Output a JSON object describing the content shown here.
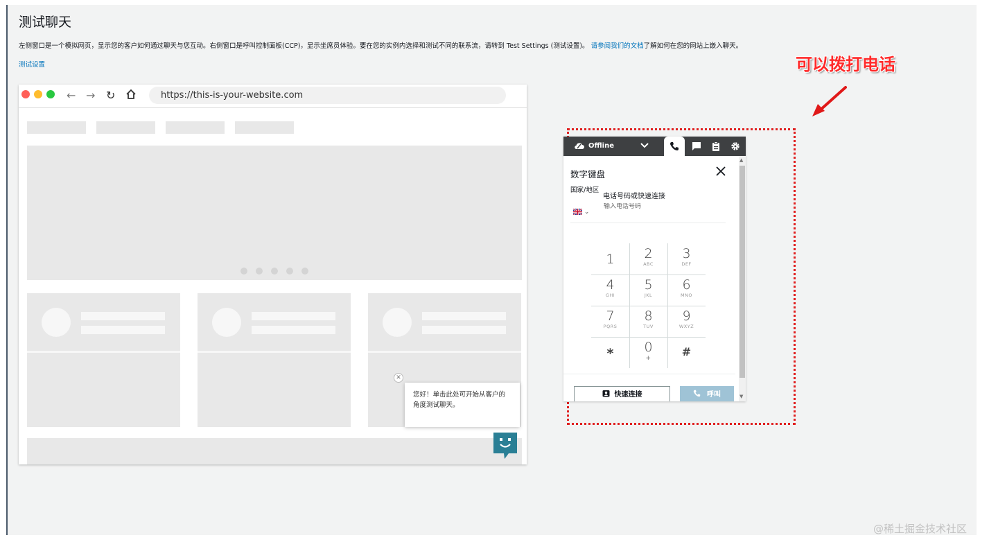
{
  "page": {
    "title": "测试聊天",
    "intro_text": "左侧窗口是一个模拟网页，显示您的客户如何通过聊天与您互动。右侧窗口是呼叫控制面板(CCP)，显示坐席员体验。要在您的实例内选择和测试不同的联系流，请转到 Test Settings (测试设置)。",
    "intro_link": "请参阅我们的文档",
    "intro_suffix": "了解如何在您的网站上嵌入聊天。",
    "test_settings_link": "测试设置"
  },
  "mock_browser": {
    "url": "https://this-is-your-website.com",
    "chat_greeting": "您好！单击此处可开始从客户的角度测试聊天。"
  },
  "ccp": {
    "status": "Offline",
    "dialpad_title": "数字键盘",
    "country_label": "国家/地区",
    "phone_label": "电话号码或快速连接",
    "phone_placeholder": "输入电话号码",
    "quick_connect_label": "快速连接",
    "call_label": "呼叫",
    "keys": [
      {
        "digit": "1",
        "letters": ""
      },
      {
        "digit": "2",
        "letters": "ABC"
      },
      {
        "digit": "3",
        "letters": "DEF"
      },
      {
        "digit": "4",
        "letters": "GHI"
      },
      {
        "digit": "5",
        "letters": "JKL"
      },
      {
        "digit": "6",
        "letters": "MNO"
      },
      {
        "digit": "7",
        "letters": "PQRS"
      },
      {
        "digit": "8",
        "letters": "TUV"
      },
      {
        "digit": "9",
        "letters": "WXYZ"
      },
      {
        "digit": "*",
        "letters": ""
      },
      {
        "digit": "0",
        "letters": "+"
      },
      {
        "digit": "#",
        "letters": ""
      }
    ],
    "icons": [
      "cloud-icon",
      "chevron-down-icon",
      "phone-icon",
      "chat-icon",
      "clipboard-icon",
      "gear-icon",
      "close-icon",
      "uk-flag-icon",
      "contact-card-icon"
    ]
  },
  "annotation": {
    "text": "可以拨打电话",
    "color": "#ff2a2a"
  },
  "watermark": "@稀土掘金技术社区",
  "colors": {
    "ccp_topbar": "#3e4042",
    "link": "#0073bb",
    "call_button": "#9fc3d6",
    "chat_launcher": "#2a7f95"
  }
}
